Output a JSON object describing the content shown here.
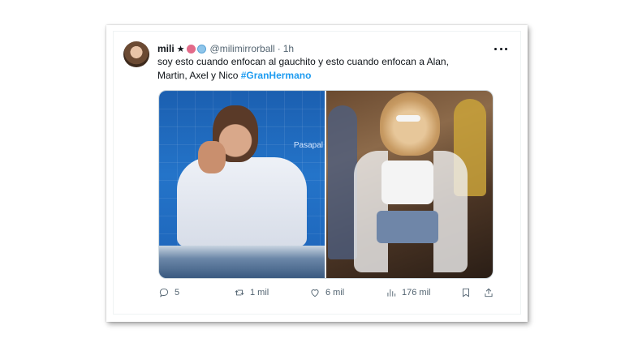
{
  "tweet": {
    "display_name": "mili",
    "handle": "@milimirrorball",
    "separator": "·",
    "time": "1h",
    "text_line1": "soy esto cuando enfocan al gauchito y esto cuando enfocan a Alan,",
    "text_line2": "Martin, Axel y Nico",
    "hashtag": "#GranHermano",
    "media_left_label": "Pasapal",
    "emoji_icons": [
      "star-icon",
      "flower-icon",
      "globe-icon"
    ]
  },
  "actions": {
    "replies": "5",
    "retweets": "1 mil",
    "likes": "6 mil",
    "views": "176 mil"
  },
  "colors": {
    "hashtag": "#1d9bf0",
    "muted": "#536471",
    "text": "#0f1419"
  }
}
